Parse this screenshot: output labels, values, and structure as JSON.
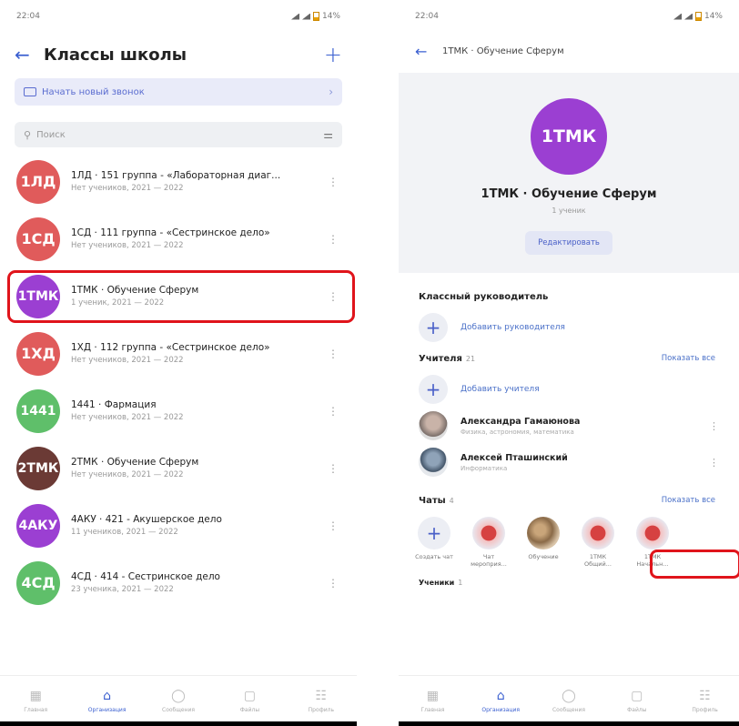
{
  "status": {
    "time": "22:04",
    "battery": "14%"
  },
  "left": {
    "title": "Классы школы",
    "call_label": "Начать новый звонок",
    "search_placeholder": "Поиск",
    "classes": [
      {
        "abbr": "1ЛД",
        "name": "1ЛД · 151 группа - «Лабораторная диаг...",
        "sub": "Нет учеников, 2021 — 2022",
        "color": "#e05b5b"
      },
      {
        "abbr": "1СД",
        "name": "1СД · 111 группа - «Сестринское дело»",
        "sub": "Нет учеников, 2021 — 2022",
        "color": "#e05b5b"
      },
      {
        "abbr": "1ТМК",
        "name": "1ТМК · Обучение Сферум",
        "sub": "1 ученик, 2021 — 2022",
        "color": "#9b3fd2"
      },
      {
        "abbr": "1ХД",
        "name": "1ХД · 112 группа - «Сестринское дело»",
        "sub": "Нет учеников, 2021 — 2022",
        "color": "#e05b5b"
      },
      {
        "abbr": "1441",
        "name": "1441 · Фармация",
        "sub": "Нет учеников, 2021 — 2022",
        "color": "#5fbf6a"
      },
      {
        "abbr": "2ТМК",
        "name": "2ТМК · Обучение Сферум",
        "sub": "Нет учеников, 2021 — 2022",
        "color": "#6b3a35"
      },
      {
        "abbr": "4АКУ",
        "name": "4АКУ · 421 - Акушерское дело",
        "sub": "11 учеников, 2021 — 2022",
        "color": "#9b3fd2"
      },
      {
        "abbr": "4СД",
        "name": "4СД · 414 - Сестринское дело",
        "sub": "23 ученика, 2021 — 2022",
        "color": "#5fbf6a"
      }
    ],
    "tabs": [
      {
        "label": "Главная",
        "icon": "grid-icon",
        "glyph": "▦"
      },
      {
        "label": "Организация",
        "icon": "school-icon",
        "glyph": "⌂"
      },
      {
        "label": "Сообщения",
        "icon": "chat-bubble-icon",
        "glyph": "◯"
      },
      {
        "label": "Файлы",
        "icon": "file-icon",
        "glyph": "▢"
      },
      {
        "label": "Профиль",
        "icon": "people-icon",
        "glyph": "☷"
      }
    ]
  },
  "right": {
    "header_title": "1ТМК · Обучение Сферум",
    "avatar_abbr": "1ТМК",
    "class_name": "1ТМК · Обучение Сферум",
    "students": "1 ученик",
    "edit_label": "Редактировать",
    "homeroom_title": "Классный руководитель",
    "add_homeroom": "Добавить руководителя",
    "teachers_title": "Учителя",
    "teachers_count": "21",
    "show_all": "Показать все",
    "add_teacher": "Добавить учителя",
    "teachers": [
      {
        "name": "Александра Гамаюнова",
        "desc": "Физика, астрономия, математика"
      },
      {
        "name": "Алексей Пташинский",
        "desc": "Информатика"
      }
    ],
    "chats_title": "Чаты",
    "chats_count": "4",
    "chats_show_all": "Показать все",
    "chats": [
      {
        "label": "Создать чат",
        "kind": "add"
      },
      {
        "label": "Чат мероприя...",
        "kind": "img"
      },
      {
        "label": "Обучение",
        "kind": "img2"
      },
      {
        "label": "1ТМК Общий...",
        "kind": "img"
      },
      {
        "label": "1ТМК Начальн...",
        "kind": "img"
      }
    ],
    "students_title": "Ученики",
    "students_count": "1",
    "tabs": [
      {
        "label": "Главная",
        "glyph": "▦"
      },
      {
        "label": "Организация",
        "glyph": "⌂"
      },
      {
        "label": "Сообщения",
        "glyph": "◯"
      },
      {
        "label": "Файлы",
        "glyph": "▢"
      },
      {
        "label": "Профиль",
        "glyph": "☷"
      }
    ]
  }
}
